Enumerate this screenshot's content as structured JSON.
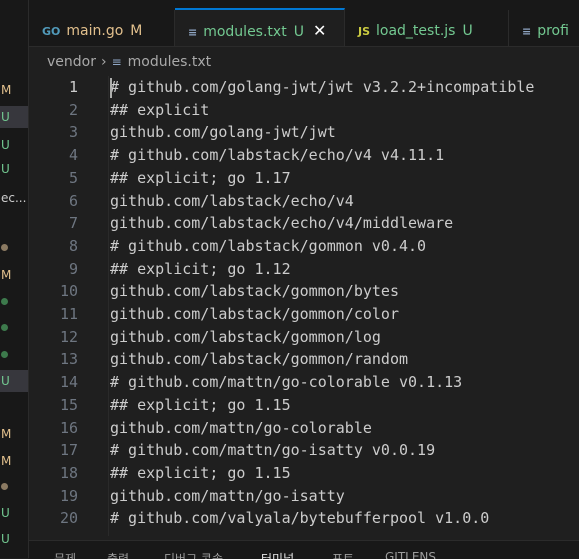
{
  "explorer_strip": [
    {
      "label": "M",
      "color": "#e2c08d"
    },
    {
      "label": "U",
      "color": "#73c991",
      "selected": true
    },
    {
      "label": "U",
      "color": "#73c991"
    },
    {
      "label": "U",
      "color": "#73c991"
    },
    {
      "label": "ec...",
      "color": "#cccccc"
    },
    {
      "label": "",
      "dot": "#8b7a62"
    },
    {
      "label": "M",
      "color": "#e2c08d"
    },
    {
      "label": "",
      "dot": "#3d7a4c"
    },
    {
      "label": "",
      "dot": "#3d7a4c"
    },
    {
      "label": "",
      "dot": "#3d7a4c"
    },
    {
      "label": "U",
      "color": "#73c991",
      "selected": true
    },
    {
      "label": "M",
      "color": "#e2c08d"
    },
    {
      "label": "M",
      "color": "#e2c08d"
    },
    {
      "label": "",
      "dot": "#8b7a62"
    },
    {
      "label": "U",
      "color": "#73c991"
    },
    {
      "label": "U",
      "color": "#73c991"
    }
  ],
  "tabs": [
    {
      "icon": "GO",
      "icon_color": "#519aba",
      "name": "main.go",
      "status": "M",
      "name_color": "#e2c08d",
      "status_color": "#e2c08d",
      "active": false
    },
    {
      "icon": "≡",
      "icon_color": "#8fa6c4",
      "name": "modules.txt",
      "status": "U",
      "name_color": "#73c991",
      "status_color": "#73c991",
      "active": true,
      "close": "✕"
    },
    {
      "icon": "JS",
      "icon_color": "#cbcb41",
      "name": "load_test.js",
      "status": "U",
      "name_color": "#73c991",
      "status_color": "#73c991",
      "active": false
    },
    {
      "icon": "≡",
      "icon_color": "#8fa6c4",
      "name": "profi",
      "status": "",
      "name_color": "#73c991",
      "status_color": "#73c991",
      "active": false
    }
  ],
  "breadcrumb": {
    "folder": "vendor",
    "separator": "›",
    "file": "modules.txt"
  },
  "current_line": 1,
  "lines": [
    "# github.com/golang-jwt/jwt v3.2.2+incompatible",
    "## explicit",
    "github.com/golang-jwt/jwt",
    "# github.com/labstack/echo/v4 v4.11.1",
    "## explicit; go 1.17",
    "github.com/labstack/echo/v4",
    "github.com/labstack/echo/v4/middleware",
    "# github.com/labstack/gommon v0.4.0",
    "## explicit; go 1.12",
    "github.com/labstack/gommon/bytes",
    "github.com/labstack/gommon/color",
    "github.com/labstack/gommon/log",
    "github.com/labstack/gommon/random",
    "# github.com/mattn/go-colorable v0.1.13",
    "## explicit; go 1.15",
    "github.com/mattn/go-colorable",
    "# github.com/mattn/go-isatty v0.0.19",
    "## explicit; go 1.15",
    "github.com/mattn/go-isatty",
    "# github.com/valyala/bytebufferpool v1.0.0"
  ],
  "panel_tabs": [
    "문제",
    "출력",
    "디버그 콘솔",
    "터미널",
    "포트",
    "GITLENS"
  ]
}
